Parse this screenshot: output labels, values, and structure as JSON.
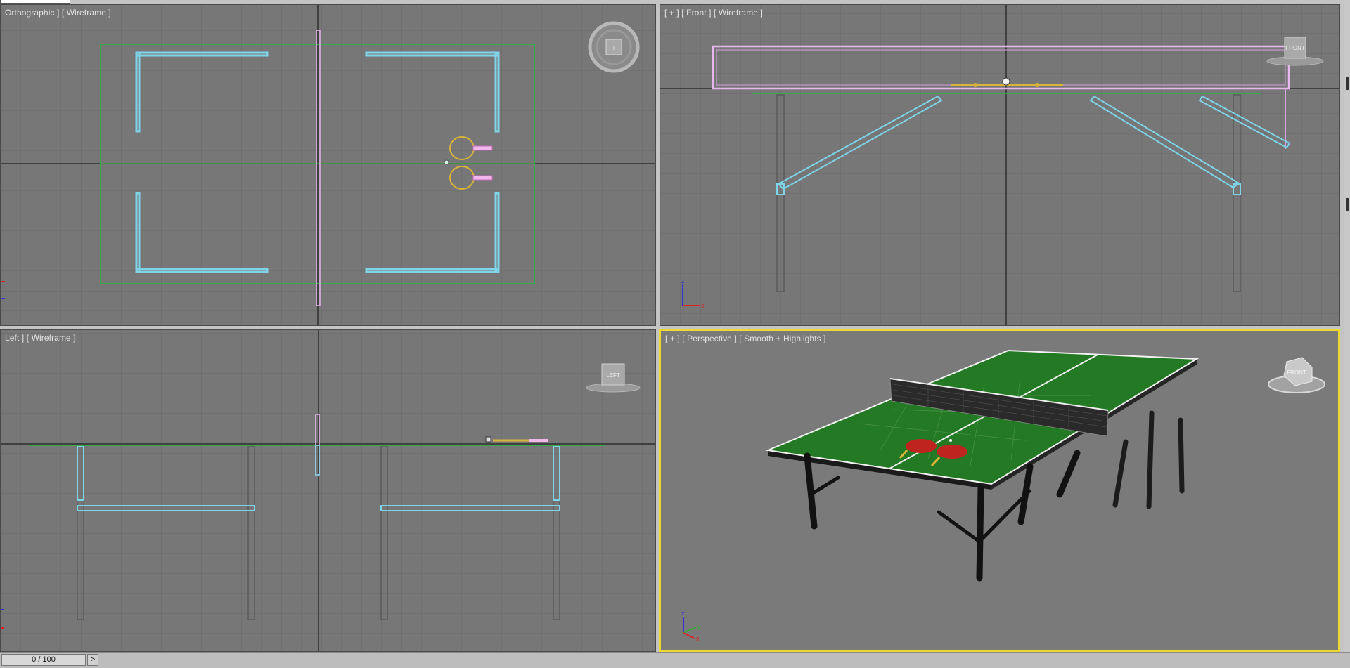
{
  "viewports": {
    "top": {
      "label": "Orthographic ] [ Wireframe ]"
    },
    "front": {
      "label": "[ + ] [ Front ] [ Wireframe ]",
      "viewcube_face": "FRONT"
    },
    "left": {
      "label": "Left ] [ Wireframe ]",
      "viewcube_face": "LEFT"
    },
    "perspective": {
      "label": "[ + ] [ Perspective ] [ Smooth + Highlights ]",
      "viewcube_face": "FRONT",
      "active": true
    }
  },
  "axis_gizmo": {
    "x": "x",
    "y": "y",
    "z": "z"
  },
  "timeline": {
    "frame_display": "0 / 100",
    "next_label": ">"
  },
  "colors": {
    "viewport_bg": "#777777",
    "grid": "#6a6a6a",
    "active_border": "#ecd931",
    "wire_cyan": "#7fd4e8",
    "wire_green": "#3aa84a",
    "wire_pink": "#e9b7f0",
    "paddle_yellow": "#d9b43a",
    "table_green": "#237a23",
    "paddle_red": "#c0241f"
  }
}
